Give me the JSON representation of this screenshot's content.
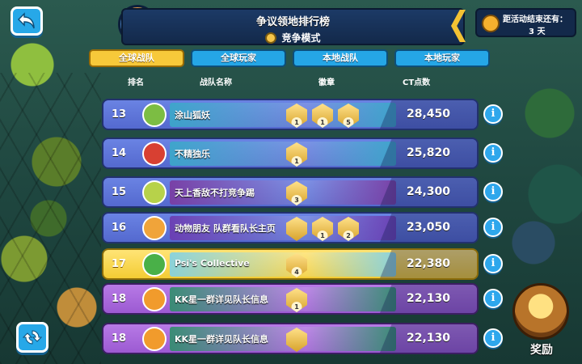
{
  "header": {
    "title": "争议领地排行榜",
    "mode": "竞争模式",
    "mode_icon": "shield-coin-icon",
    "avatar_icon": "monkey-avatar-icon"
  },
  "timer": {
    "label": "距活动结束还有：",
    "value": "3 天",
    "icon": "stopwatch-icon"
  },
  "tabs": [
    {
      "label": "全球战队",
      "active": true
    },
    {
      "label": "全球玩家",
      "active": false
    },
    {
      "label": "本地战队",
      "active": false
    },
    {
      "label": "本地玩家",
      "active": false
    }
  ],
  "columns": {
    "rank": "排名",
    "team_name": "战队名称",
    "badges": "徽章",
    "points": "CT点数"
  },
  "rows": [
    {
      "rank": "13",
      "name": "涂山狐妖",
      "badges": [
        "1",
        "1",
        "5"
      ],
      "points": "28,450",
      "style": "blue",
      "icon_color": "#7cbd43",
      "banner": "#3aa9c9"
    },
    {
      "rank": "14",
      "name": "不精独乐",
      "badges": [
        "1"
      ],
      "points": "25,820",
      "style": "blue",
      "icon_color": "#d84032",
      "banner": "#3aa9c9"
    },
    {
      "rank": "15",
      "name": "天上香敌不打竞争踢",
      "badges": [
        "3"
      ],
      "points": "24,300",
      "style": "blue",
      "icon_color": "#b7d24a",
      "banner": "#7b3aa0"
    },
    {
      "rank": "16",
      "name": "动物朋友 队群看队长主页",
      "badges": [
        "",
        "1",
        "2"
      ],
      "points": "23,050",
      "style": "blue",
      "icon_color": "#f0a43a",
      "banner": "#6c3bb0"
    },
    {
      "rank": "17",
      "name": "Psi's Collective",
      "badges": [
        "4"
      ],
      "points": "22,380",
      "style": "yellow",
      "icon_color": "#49b048",
      "banner": "#7fd1e8"
    },
    {
      "rank": "18",
      "name": "KK星一群详见队长信息",
      "badges": [
        "1"
      ],
      "points": "22,130",
      "style": "purple",
      "icon_color": "#f19b2c",
      "banner": "#2e8f6a"
    },
    {
      "rank": "18",
      "name": "KK星一群详见队长信息",
      "badges": [
        ""
      ],
      "points": "22,130",
      "style": "purple",
      "icon_color": "#f19b2c",
      "banner": "#2e8f6a"
    }
  ],
  "reward": {
    "label": "奖励",
    "icon": "treasure-chest-icon"
  },
  "buttons": {
    "back_icon": "back-arrow-icon",
    "refresh_icon": "refresh-icon",
    "info_label": "i"
  },
  "colors": {
    "tab_active": "#f7c93a",
    "tab_inactive": "#25a6e6",
    "row_blue": "#5f78db",
    "row_highlight": "#f3cc33",
    "row_purple": "#a564d8"
  }
}
